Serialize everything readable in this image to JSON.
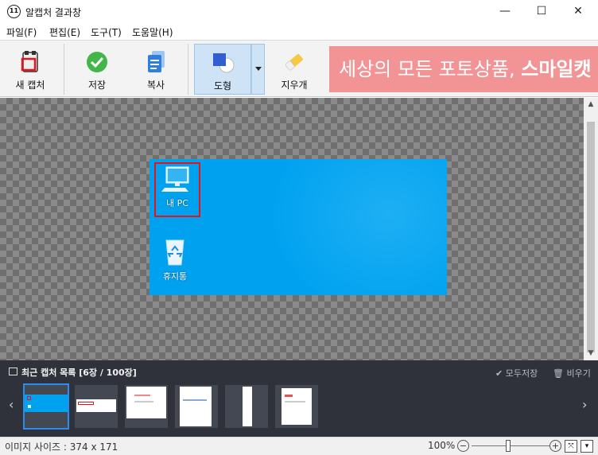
{
  "window": {
    "title": "알캡처 결과창",
    "app_icon_text": "11",
    "minimize": "—",
    "maximize": "☐",
    "close": "✕"
  },
  "menu": [
    "파일(F)",
    "편집(E)",
    "도구(T)",
    "도움말(H)"
  ],
  "toolbar": {
    "new_capture": "새 캡처",
    "save": "저장",
    "copy": "복사",
    "shape": "도형",
    "eraser": "지우개",
    "ad_text": "세상의 모든 포토상품, ",
    "ad_bold": "스마일캣"
  },
  "capture": {
    "my_pc_label": "내 PC",
    "recycle_label": "휴지통"
  },
  "recent": {
    "title": "최근 캡처 목록 [6장 / 100장]",
    "save_all": "✔ 모두저장",
    "clear": "🗑 비우기",
    "prev": "‹",
    "next": "›",
    "thumbnails": 6,
    "selected_index": 0
  },
  "status": {
    "image_size": "이미지 사이즈 : 374 x 171",
    "zoom": "100%",
    "zoom_minus": "−",
    "zoom_plus": "+",
    "zoom_level": 0.5
  },
  "colors": {
    "accent": "#2b8cf0",
    "desktop_bg": "#00a2f0",
    "ad_bg": "#f29396",
    "highlight": "#e5141c"
  }
}
